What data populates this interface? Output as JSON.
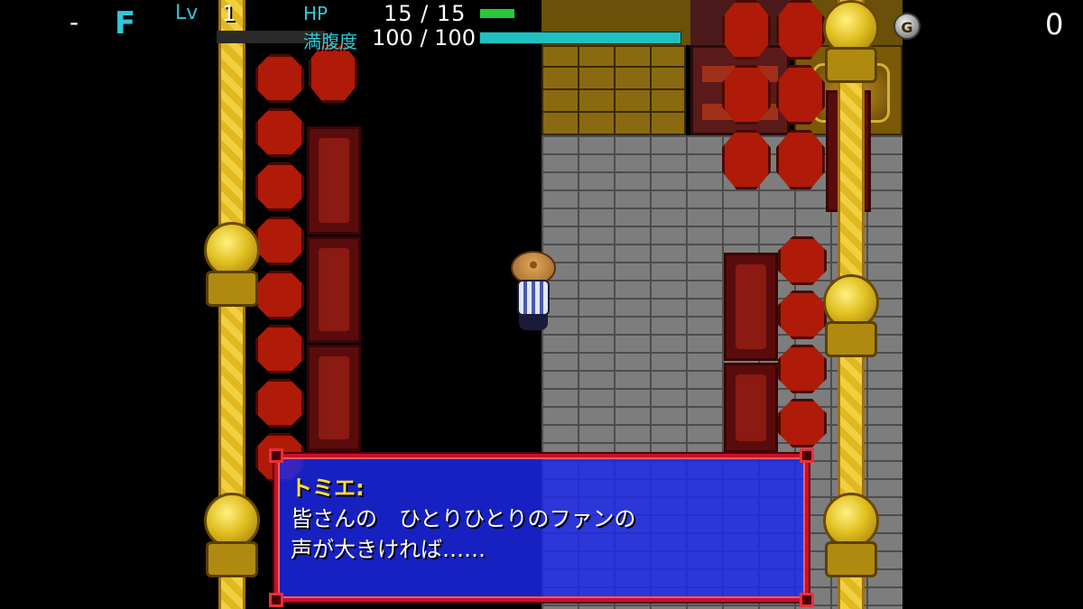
{
  "hud": {
    "floor_prefix": "-",
    "floor_letter": "F",
    "level_label": "Lv",
    "level_value": "1",
    "hp_label": "HP",
    "hp_value": "15 /  15",
    "hp_ratio": 1.0,
    "satiety_label": "満腹度",
    "satiety_value": "100 / 100",
    "satiety_ratio": 1.0,
    "gitan_icon": "gitan-coin-icon",
    "gitan_value": "0",
    "colors": {
      "label": "#30c8d8",
      "hp_bar": "#28c838",
      "satiety_bar": "#20c0c0"
    }
  },
  "dialog": {
    "speaker": "トミエ:",
    "lines": [
      "皆さんの　ひとりひとりのファンの",
      "声が大きければ……"
    ],
    "colors": {
      "background": "#1c28eb",
      "border": "#c8102a",
      "speaker": "#ffe030"
    }
  },
  "scene": {
    "player": "straw-hat-wanderer",
    "floor": "stone-brick"
  }
}
